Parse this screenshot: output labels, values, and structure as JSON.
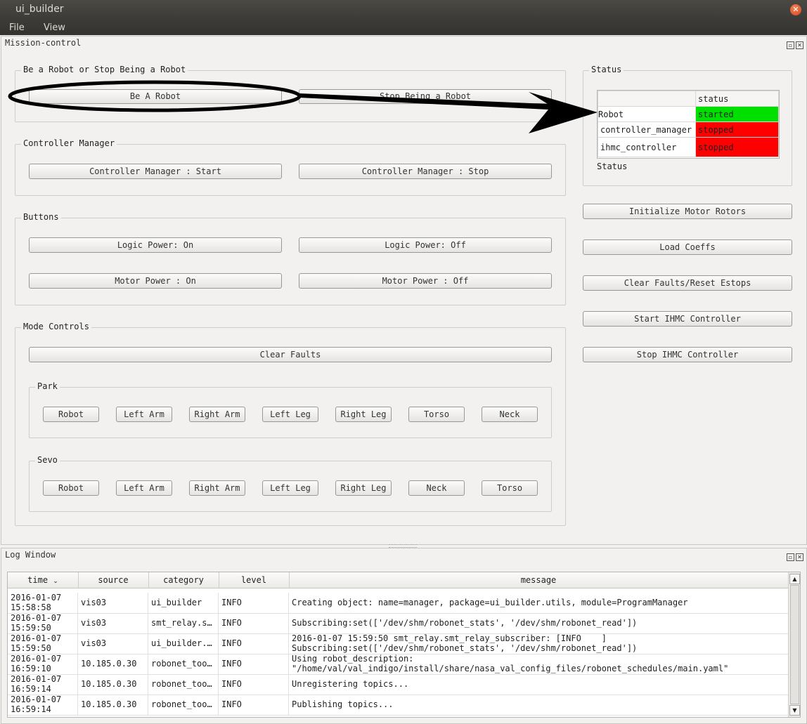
{
  "window": {
    "title": "ui_builder"
  },
  "menu": {
    "file": "File",
    "view": "View"
  },
  "mission_dock": {
    "title": "Mission-control"
  },
  "groups": {
    "robot": {
      "title": "Be a Robot or Stop Being a Robot",
      "be_robot": "Be A Robot",
      "stop_robot": "Stop Being a Robot"
    },
    "controller": {
      "title": "Controller Manager",
      "start": "Controller Manager : Start",
      "stop": "Controller Manager : Stop"
    },
    "buttons": {
      "title": "Buttons",
      "logic_on": "Logic Power: On",
      "logic_off": "Logic Power: Off",
      "motor_on": "Motor Power : On",
      "motor_off": "Motor Power : Off"
    },
    "mode": {
      "title": "Mode Controls",
      "clear_faults": "Clear Faults",
      "park": {
        "title": "Park",
        "buttons": [
          "Robot",
          "Left Arm",
          "Right Arm",
          "Left Leg",
          "Right Leg",
          "Torso",
          "Neck"
        ]
      },
      "sevo": {
        "title": "Sevo",
        "buttons": [
          "Robot",
          "Left Arm",
          "Right Arm",
          "Left Leg",
          "Right Leg",
          "Neck",
          "Torso"
        ]
      }
    }
  },
  "status": {
    "title": "Status",
    "column": "status",
    "rows": [
      {
        "name": "Robot",
        "state": "started",
        "color": "#00e000"
      },
      {
        "name": "controller_manager",
        "state": "stopped",
        "color": "#ff0000"
      },
      {
        "name": "ihmc_controller",
        "state": "stopped",
        "color": "#ff0000"
      }
    ],
    "footer": "Status"
  },
  "actions": [
    "Initialize Motor Rotors",
    "Load Coeffs",
    "Clear Faults/Reset Estops",
    "Start IHMC Controller",
    "Stop IHMC Controller"
  ],
  "log": {
    "title": "Log Window",
    "columns": [
      "time",
      "source",
      "category",
      "level",
      "message"
    ],
    "rows": [
      {
        "time": "2016-01-07\n15:58:58",
        "source": "vis03",
        "category": "ui_builder",
        "level": "INFO",
        "message": "Creating object: name=manager, package=ui_builder.utils, module=ProgramManager"
      },
      {
        "time": "2016-01-07\n15:59:50",
        "source": "vis03",
        "category": "smt_relay.s…",
        "level": "INFO",
        "message": "Subscribing:set(['/dev/shm/robonet_stats', '/dev/shm/robonet_read'])"
      },
      {
        "time": "2016-01-07\n15:59:50",
        "source": "vis03",
        "category": "ui_builder.…",
        "level": "INFO",
        "message": "2016-01-07 15:59:50 smt_relay.smt_relay_subscriber: [INFO    ]\nSubscribing:set(['/dev/shm/robonet_stats', '/dev/shm/robonet_read'])"
      },
      {
        "time": "2016-01-07\n16:59:10",
        "source": "10.185.0.30",
        "category": "robonet_too…",
        "level": "INFO",
        "message": "Using robot_description:\n\"/home/val/val_indigo/install/share/nasa_val_config_files/robonet_schedules/main.yaml\""
      },
      {
        "time": "2016-01-07\n16:59:14",
        "source": "10.185.0.30",
        "category": "robonet_too…",
        "level": "INFO",
        "message": "Unregistering topics..."
      },
      {
        "time": "2016-01-07\n16:59:14",
        "source": "10.185.0.30",
        "category": "robonet_too…",
        "level": "INFO",
        "message": "Publishing topics..."
      }
    ]
  }
}
